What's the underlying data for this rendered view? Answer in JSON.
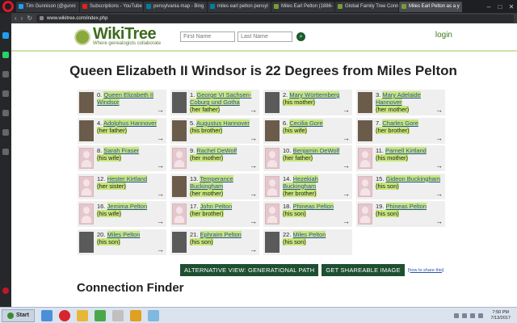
{
  "browser": {
    "tabs": [
      {
        "label": "Tim Gunnison (@gunni",
        "color": "#1da1f2"
      },
      {
        "label": "Subscriptions - YouTube",
        "color": "#e62117"
      },
      {
        "label": "pensylvania map - Bing",
        "color": "#00809d"
      },
      {
        "label": "miles earl pelton pensyl",
        "color": "#00809d"
      },
      {
        "label": "Miles Earl Pelton (1886-",
        "color": "#7a9a3a"
      },
      {
        "label": "Global Family Tree Conn",
        "color": "#7a9a3a"
      },
      {
        "label": "Miles Earl Pelton as a y",
        "color": "#7a9a3a"
      }
    ],
    "url": "www.wikitree.com/index.php",
    "win_min": "–",
    "win_max": "□",
    "win_close": "✕"
  },
  "site": {
    "logo_name": "WikiTree",
    "logo_tagline": "Where genealogists collaborate",
    "first_name_placeholder": "First Name",
    "last_name_placeholder": "Last Name",
    "login": "login"
  },
  "main": {
    "title": "Queen Elizabeth II Windsor is 22 Degrees from Miles Pelton",
    "people": [
      {
        "num": "0.",
        "name": "Queen Elizabeth II Windsor",
        "rel": "",
        "thumb": "photo"
      },
      {
        "num": "1.",
        "name": "George VI Sachsen-Coburg und Gotha",
        "rel": "(her father)",
        "thumb": "bw"
      },
      {
        "num": "2.",
        "name": "Mary Württemberg",
        "rel": "(his mother)",
        "thumb": "bw"
      },
      {
        "num": "3.",
        "name": "Mary Adelaide Hannover",
        "rel": "(her mother)",
        "thumb": "photo"
      },
      {
        "num": "4.",
        "name": "Adolphus Hannover",
        "rel": "(her father)",
        "thumb": "photo"
      },
      {
        "num": "5.",
        "name": "Augustus Hannover",
        "rel": "(his brother)",
        "thumb": "photo"
      },
      {
        "num": "6.",
        "name": "Cecilia Gore",
        "rel": "(his wife)",
        "thumb": "photo"
      },
      {
        "num": "7.",
        "name": "Charles Gore",
        "rel": "(her brother)",
        "thumb": "photo"
      },
      {
        "num": "8.",
        "name": "Sarah Fraser",
        "rel": "(his wife)",
        "thumb": "blank"
      },
      {
        "num": "9.",
        "name": "Rachel DeWolf",
        "rel": "(her mother)",
        "thumb": "blank"
      },
      {
        "num": "10.",
        "name": "Benjamin DeWolf",
        "rel": "(her father)",
        "thumb": "blank"
      },
      {
        "num": "11.",
        "name": "Parnell Kirtland",
        "rel": "(his mother)",
        "thumb": "blank"
      },
      {
        "num": "12.",
        "name": "Hester Kirtland",
        "rel": "(her sister)",
        "thumb": "blank"
      },
      {
        "num": "13.",
        "name": "Temperance Buckingham",
        "rel": "(her mother)",
        "thumb": "photo"
      },
      {
        "num": "14.",
        "name": "Hezekiah Buckingham",
        "rel": "(her brother)",
        "thumb": "blank"
      },
      {
        "num": "15.",
        "name": "Gideon Buckingham",
        "rel": "(his son)",
        "thumb": "blank"
      },
      {
        "num": "16.",
        "name": "Jemima Pelton",
        "rel": "(his wife)",
        "thumb": "blank"
      },
      {
        "num": "17.",
        "name": "John Pelton",
        "rel": "(her brother)",
        "thumb": "blank"
      },
      {
        "num": "18.",
        "name": "Phineas Pelton",
        "rel": "(his son)",
        "thumb": "blank"
      },
      {
        "num": "19.",
        "name": "Phineas Pelton",
        "rel": "(his son)",
        "thumb": "blank"
      },
      {
        "num": "20.",
        "name": "Miles Pelton",
        "rel": "(his son)",
        "thumb": "bw"
      },
      {
        "num": "21.",
        "name": "Ephraim Pelton",
        "rel": "(his son)",
        "thumb": "bw"
      },
      {
        "num": "22.",
        "name": "Miles Pelton",
        "rel": "(his son)",
        "thumb": "bw"
      }
    ],
    "arrow": "→",
    "alt_view_label": "ALTERNATIVE VIEW: GENERATIONAL PATH",
    "share_label": "GET SHAREABLE IMAGE",
    "howto_label": "[how to share this]",
    "connection_finder": "Connection Finder"
  },
  "taskbar": {
    "start": "Start",
    "time": "7:50 PM",
    "date": "7/13/2017"
  }
}
